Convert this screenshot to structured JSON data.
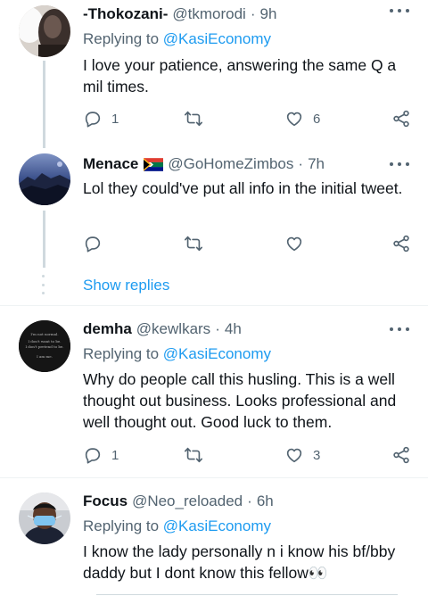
{
  "tweets": [
    {
      "name": "-Thokozani-",
      "handle": "@tkmorodi",
      "dot": "·",
      "time": "9h",
      "replying_prefix": "Replying to",
      "replying_to": "@KasiEconomy",
      "text": "I love  your  patience, answering the same Q a mil times.",
      "replies": "1",
      "retweets": "",
      "likes": "6"
    },
    {
      "name": "Menace",
      "handle": "@GoHomeZimbos",
      "dot": "·",
      "time": "7h",
      "text": "Lol they could've put all info in the initial tweet.",
      "replies": "",
      "retweets": "",
      "likes": ""
    },
    {
      "name": "demha",
      "handle": "@kewlkars",
      "dot": "·",
      "time": "4h",
      "replying_prefix": "Replying to",
      "replying_to": "@KasiEconomy",
      "text": "Why do people call this husling. This is a well thought out business. Looks professional and well thought out. Good luck to them.",
      "replies": "1",
      "retweets": "",
      "likes": "3",
      "avatar_text": [
        "I'm not normal.",
        "I don't want to be.",
        "I don't pretend to be.",
        "I am me."
      ]
    },
    {
      "name": "Focus",
      "handle": "@Neo_reloaded",
      "dot": "·",
      "time": "6h",
      "replying_prefix": "Replying to",
      "replying_to": "@KasiEconomy",
      "text": "I know the lady personally n i know his bf/bby daddy but I dont know this fellow👀"
    }
  ],
  "show_replies": "Show replies",
  "colors": {
    "accent": "#1d9bf0",
    "secondary_text": "#536471",
    "thread_line": "#cfd9de"
  }
}
